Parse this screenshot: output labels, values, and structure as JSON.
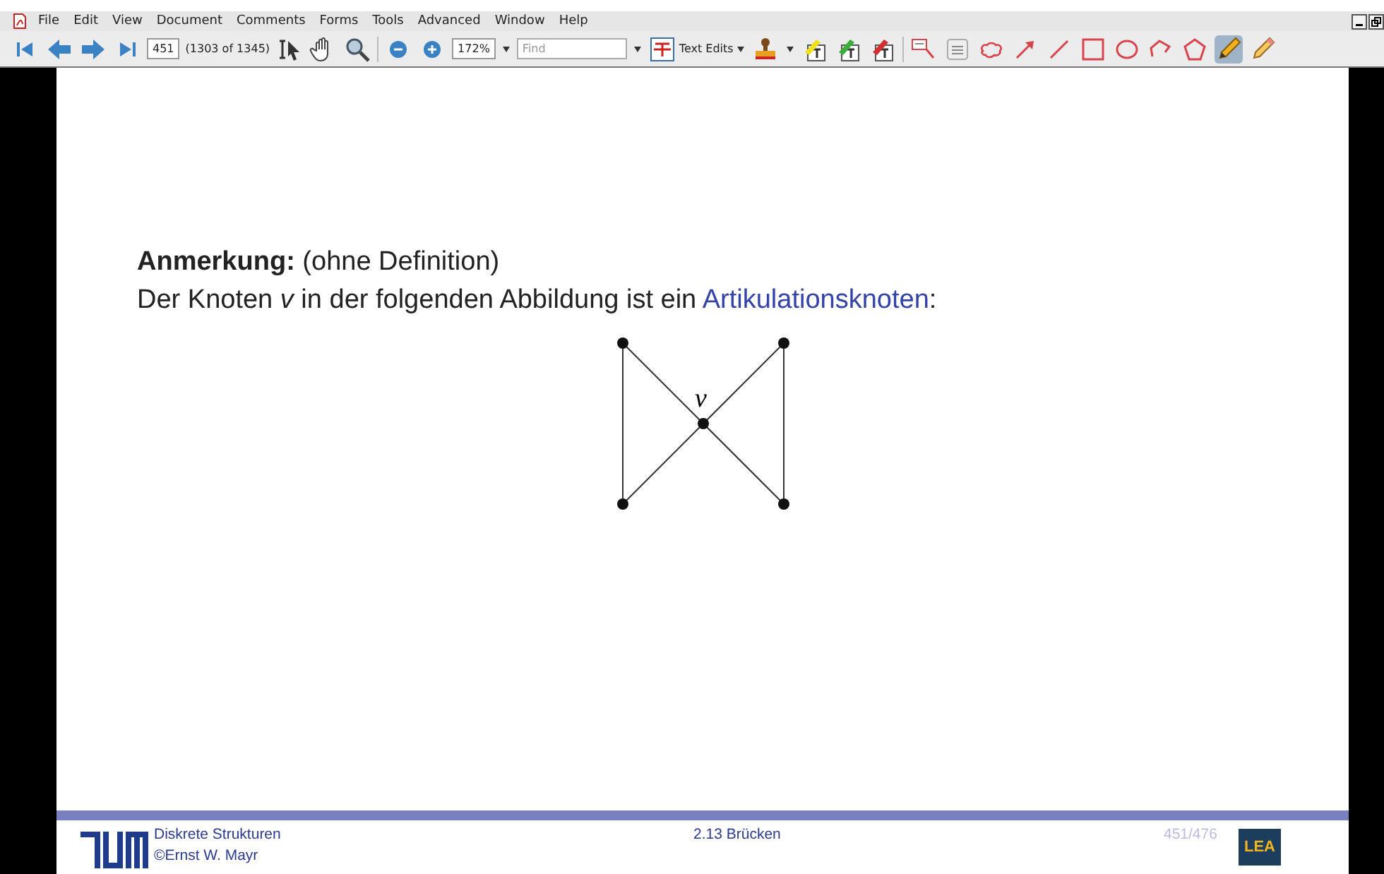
{
  "menu": [
    "File",
    "Edit",
    "View",
    "Document",
    "Comments",
    "Forms",
    "Tools",
    "Advanced",
    "Window",
    "Help"
  ],
  "toolbar": {
    "page_field": "451",
    "page_count": "(1303 of 1345)",
    "zoom_field": "172%",
    "find": {
      "placeholder": "Find"
    },
    "text_edits": "Text Edits",
    "tools": [
      {
        "kind": "callout",
        "selected": false
      },
      {
        "kind": "note",
        "selected": false
      },
      {
        "kind": "cloud",
        "selected": false
      },
      {
        "kind": "arrow",
        "selected": false
      },
      {
        "kind": "line",
        "selected": false
      },
      {
        "kind": "rectangle",
        "selected": false
      },
      {
        "kind": "ellipse",
        "selected": false
      },
      {
        "kind": "polyline",
        "selected": false
      },
      {
        "kind": "polygon",
        "selected": false
      },
      {
        "kind": "pencil",
        "selected": true
      },
      {
        "kind": "eraser",
        "selected": false
      }
    ]
  },
  "slide": {
    "remark": "**Anmerkung:** (ohne Definition)",
    "sentence": {
      "before": "Der Knoten *v* in der folgenden Abbildung ist ein ",
      "link": "Artikulationsknoten",
      "after": ":"
    },
    "graph": {
      "vertex_label": "v"
    },
    "footer": {
      "course": "Diskrete Strukturen",
      "author": "©Ernst W. Mayr",
      "section": "2.13 Brücken",
      "page": "451/476",
      "logo_text": "LEA"
    }
  }
}
